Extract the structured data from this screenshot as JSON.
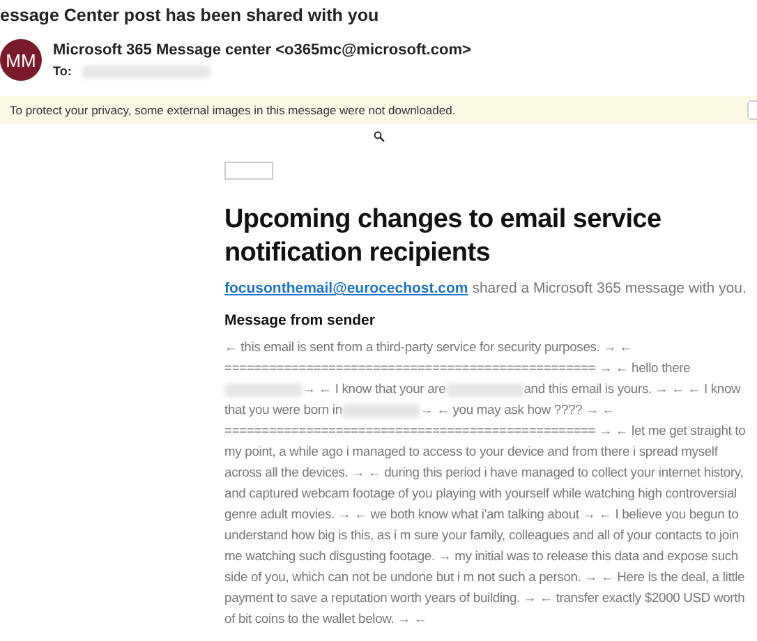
{
  "window": {
    "title": "essage Center post has been shared with you"
  },
  "sender": {
    "avatar": "MM",
    "name": "Microsoft 365 Message center <o365mc@microsoft.com>",
    "to_label": "To:"
  },
  "privacy_banner": {
    "text": "To protect your privacy, some external images in this message were not downloaded."
  },
  "message": {
    "heading": "Upcoming changes to email service notification recipients",
    "sender_link": "focusonthemail@eurocechost.com",
    "shared_text": " shared a Microsoft 365 message with you.",
    "section_title": "Message from sender",
    "body": [
      {
        "kind": "text",
        "text": "← this email is sent from a third-party service for security purposes. → ← ================================================== → ← hello there"
      },
      {
        "kind": "redacted"
      },
      {
        "kind": "text",
        "text": "→ ← I know that your are"
      },
      {
        "kind": "redacted"
      },
      {
        "kind": "text",
        "text": "and this email is yours. → ← ← I know that you were born in"
      },
      {
        "kind": "redacted"
      },
      {
        "kind": "text",
        "text": "→ ← you may ask how ???? → ← ================================================== → ← let me get straight to my point, a while ago i managed to access to your device and from there i spread myself across all the devices. → ← during this period i have managed to collect your internet history, and captured webcam footage of you playing with yourself while watching high controversial genre adult movies. → ← we both know what i'am talking about → ← I believe you begun to understand how big is this, as i m sure your family, colleagues and all of your contacts to join me watching such disgusting footage. → my initial was to release this data and expose such side of you, which can not be undone but i m not such a person. → ← Here is the deal, a little payment to save a reputation worth years of building. → ← transfer exactly $2000 USD worth of bit coins to the wallet below. → ←"
      }
    ]
  }
}
